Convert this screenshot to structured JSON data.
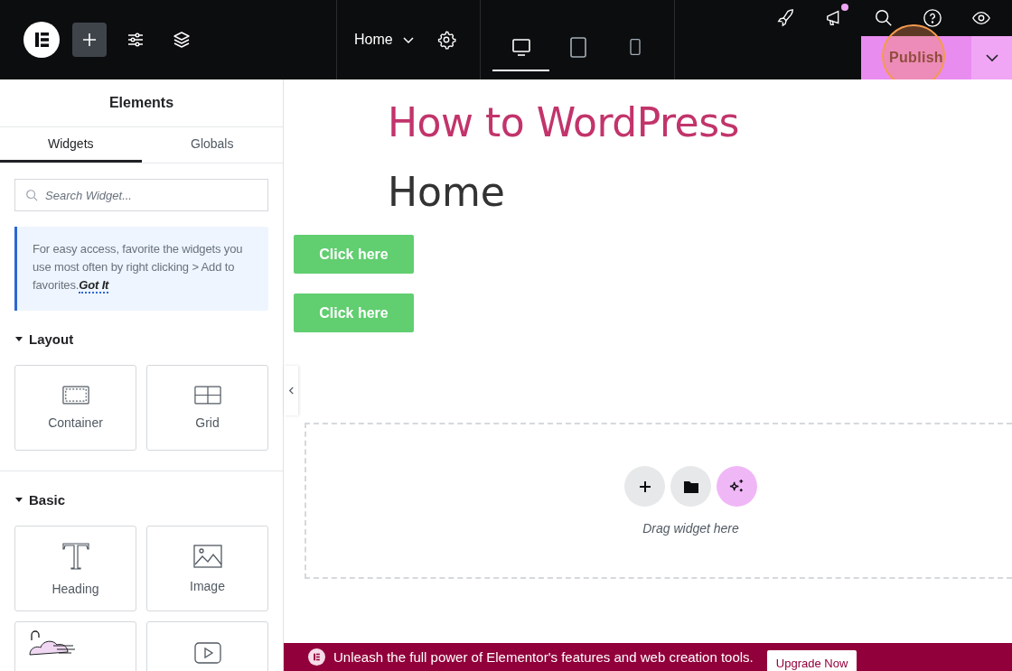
{
  "topbar": {
    "page_title": "Home",
    "devices": [
      {
        "kind": "desktop",
        "selected": true
      },
      {
        "kind": "tablet",
        "selected": false
      },
      {
        "kind": "mobile",
        "selected": false
      }
    ],
    "notification": true,
    "publish": "Publish"
  },
  "panel": {
    "title": "Elements",
    "tabs": [
      {
        "label": "Widgets",
        "selected": true
      },
      {
        "label": "Globals",
        "selected": false
      }
    ],
    "search": {
      "placeholder": "Search Widget..."
    },
    "tip": {
      "text": "For easy access, favorite the widgets you use most often by right clicking > Add to favorites.",
      "link": "Got It"
    },
    "sections": [
      {
        "title": "Layout",
        "expanded": true,
        "widgets": [
          {
            "kind": "container",
            "label": "Container"
          },
          {
            "kind": "grid",
            "label": "Grid"
          }
        ]
      },
      {
        "title": "Basic",
        "expanded": true,
        "widgets": [
          {
            "kind": "heading",
            "label": "Heading"
          },
          {
            "kind": "image",
            "label": "Image"
          },
          {
            "kind": "illustration"
          },
          {
            "kind": "video"
          }
        ]
      }
    ]
  },
  "canvas": {
    "site_title": "How to WordPress",
    "page_heading": "Home",
    "buttons": [
      "Click here",
      "Click here"
    ],
    "drop_hint": "Drag widget here"
  },
  "banner": {
    "text": "Unleash the full power of Elementor's features and web creation tools.",
    "button": "Upgrade Now"
  }
}
